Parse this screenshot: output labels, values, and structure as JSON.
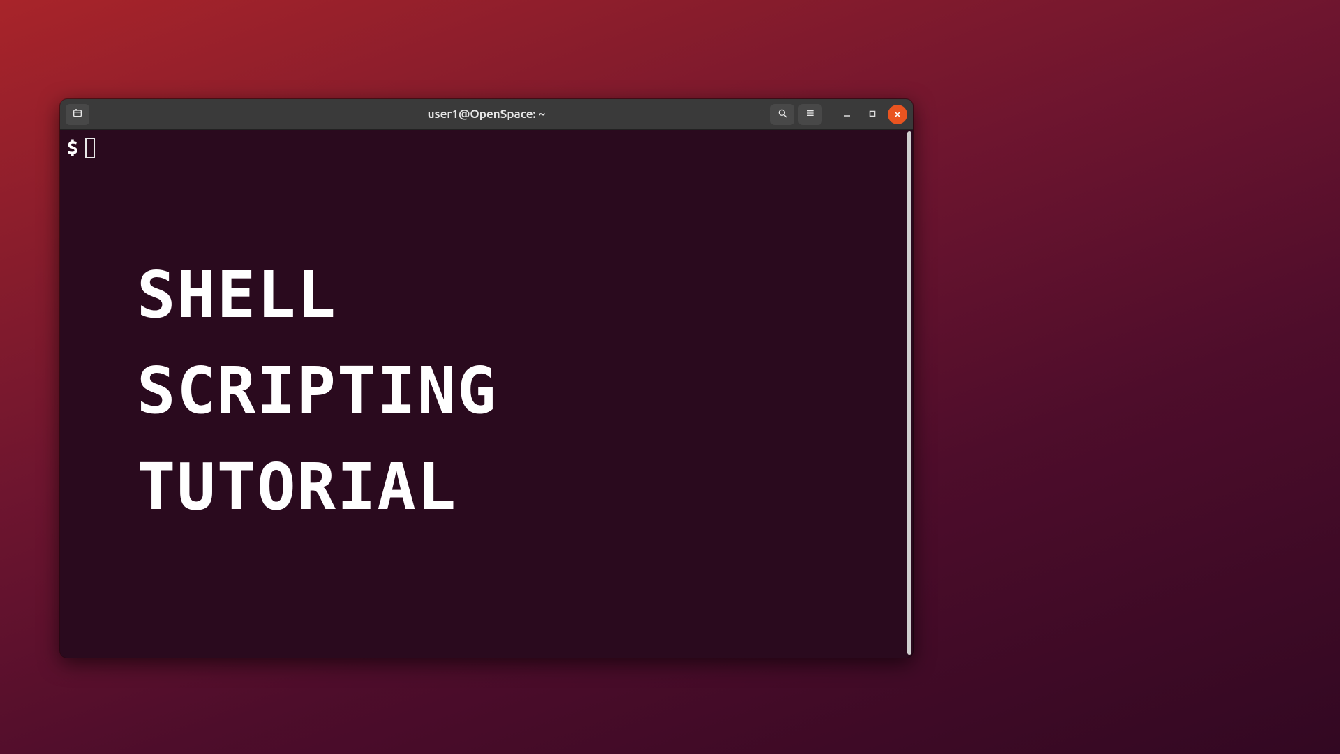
{
  "window": {
    "title": "user1@OpenSpace: ~"
  },
  "terminal": {
    "prompt": "$",
    "banner": {
      "line1": "SHELL",
      "line2": "SCRIPTING",
      "line3": "TUTORIAL"
    }
  },
  "colors": {
    "close_button": "#E95420",
    "terminal_bg": "#2a0a1e",
    "titlebar_bg": "#3a3a3a"
  }
}
